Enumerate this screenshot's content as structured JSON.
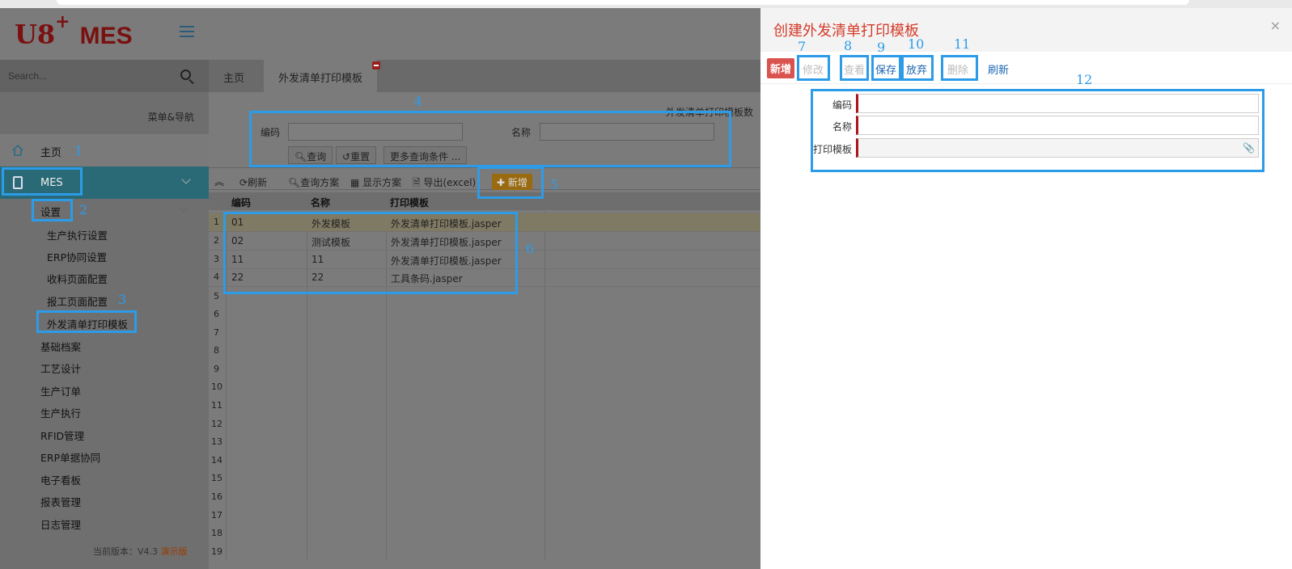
{
  "app": {
    "logo_brand": "U8",
    "logo_plus": "+",
    "logo_product": "MES"
  },
  "sidebar": {
    "search_placeholder": "Search...",
    "nav_title": "菜单&导航",
    "home": "主页",
    "mes": "MES",
    "settings": "设置",
    "settings_items": [
      "生产执行设置",
      "ERP协同设置",
      "收料页面配置",
      "报工页面配置",
      "外发清单打印模板"
    ],
    "groups": [
      "基础档案",
      "工艺设计",
      "生产订单",
      "生产执行",
      "RFID管理",
      "ERP单据协同",
      "电子看板",
      "报表管理",
      "日志管理"
    ],
    "version_label": "当前版本：V4.3",
    "version_tag": "演示版"
  },
  "tabs": [
    "主页",
    "外发清单打印模板"
  ],
  "breadcrumb": "外发清单打印模板数",
  "query": {
    "code_label": "编码",
    "name_label": "名称",
    "code_value": "",
    "name_value": "",
    "btn_query": "查询",
    "btn_reset": "重置",
    "btn_more": "更多查询条件 ..."
  },
  "toolbar": {
    "refresh": "刷新",
    "query_scheme": "查询方案",
    "display_scheme": "显示方案",
    "export": "导出(excel)",
    "new": "新增"
  },
  "grid": {
    "headers": [
      "编码",
      "名称",
      "打印模板"
    ],
    "rows": [
      {
        "n": "1",
        "code": "01",
        "name": "外发模板",
        "tpl": "外发清单打印模板.jasper"
      },
      {
        "n": "2",
        "code": "02",
        "name": "测试模板",
        "tpl": "外发清单打印模板.jasper"
      },
      {
        "n": "3",
        "code": "11",
        "name": "11",
        "tpl": "外发清单打印模板.jasper"
      },
      {
        "n": "4",
        "code": "22",
        "name": "22",
        "tpl": "工具条码.jasper"
      }
    ],
    "empty_rows": [
      "5",
      "6",
      "7",
      "8",
      "9",
      "10",
      "11",
      "12",
      "13",
      "14",
      "15",
      "16",
      "17",
      "18",
      "19"
    ]
  },
  "panel": {
    "title": "创建外发清单打印模板",
    "close": "×",
    "buttons": {
      "new": "新增",
      "edit": "修改",
      "view": "查看",
      "save": "保存",
      "discard": "放弃",
      "delete": "删除",
      "refresh": "刷新"
    },
    "form": {
      "code_label": "编码",
      "name_label": "名称",
      "template_label": "打印模板",
      "code_value": "",
      "name_value": "",
      "template_value": ""
    }
  },
  "annotations": [
    "1",
    "2",
    "3",
    "4",
    "5",
    "6",
    "7",
    "8",
    "9",
    "10",
    "11",
    "12"
  ],
  "colors": {
    "accent": "#2d9ce8",
    "title_red": "#d43b2a",
    "nav_active": "#2a6a76"
  }
}
